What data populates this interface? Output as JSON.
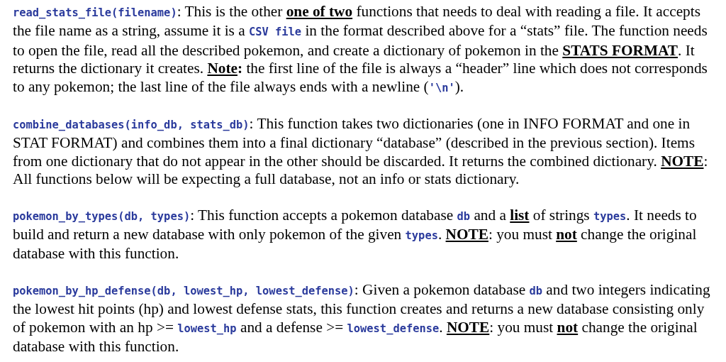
{
  "paragraphs": [
    {
      "segments": [
        {
          "kind": "code",
          "text": "read_stats_file(filename)"
        },
        {
          "kind": "text",
          "text": ": This is the other "
        },
        {
          "kind": "emph",
          "text": "one of two"
        },
        {
          "kind": "text",
          "text": " functions that needs to deal with reading a file. It accepts the file name as a string, assume it is a "
        },
        {
          "kind": "code",
          "text": "CSV file"
        },
        {
          "kind": "text",
          "text": " in the format described above for a “stats” file. The function needs to open the file, read all the described pokemon, and create a dictionary of pokemon in the "
        },
        {
          "kind": "emph",
          "text": "STATS FORMAT"
        },
        {
          "kind": "text",
          "text": ". It returns the dictionary it creates. "
        },
        {
          "kind": "emph",
          "text": "Note"
        },
        {
          "kind": "bold",
          "text": ":"
        },
        {
          "kind": "text",
          "text": " the first line of the file is always a “header” line which does not corresponds to any pokemon; the last line of the file always ends with a newline ("
        },
        {
          "kind": "code",
          "text": "'\\n'"
        },
        {
          "kind": "text",
          "text": ")."
        }
      ]
    },
    {
      "segments": [
        {
          "kind": "code",
          "text": "combine_databases(info_db, stats_db)"
        },
        {
          "kind": "text",
          "text": ": This function takes two dictionaries (one in INFO FORMAT and one in STAT FORMAT) and combines them into a final dictionary “database” (described in the previous section). Items from one dictionary that do not appear in the other should be discarded. It returns the combined dictionary. "
        },
        {
          "kind": "emph",
          "text": "NOTE"
        },
        {
          "kind": "text",
          "text": ": All functions below will be expecting a full database, not an info or stats dictionary."
        }
      ]
    },
    {
      "segments": [
        {
          "kind": "code",
          "text": "pokemon_by_types(db, types)"
        },
        {
          "kind": "text",
          "text": ": This function accepts a pokemon database "
        },
        {
          "kind": "code",
          "text": "db"
        },
        {
          "kind": "text",
          "text": " and a "
        },
        {
          "kind": "emph",
          "text": "list"
        },
        {
          "kind": "text",
          "text": " of strings "
        },
        {
          "kind": "code",
          "text": "types"
        },
        {
          "kind": "text",
          "text": ". It needs to build and return a new database with only pokemon of the given "
        },
        {
          "kind": "code",
          "text": "types"
        },
        {
          "kind": "text",
          "text": ". "
        },
        {
          "kind": "emph",
          "text": "NOTE"
        },
        {
          "kind": "text",
          "text": ": you must "
        },
        {
          "kind": "emph",
          "text": "not"
        },
        {
          "kind": "text",
          "text": " change the original database with this function."
        }
      ]
    },
    {
      "segments": [
        {
          "kind": "code",
          "text": "pokemon_by_hp_defense(db, lowest_hp, lowest_defense)"
        },
        {
          "kind": "text",
          "text": ": Given a pokemon database "
        },
        {
          "kind": "code",
          "text": "db"
        },
        {
          "kind": "text",
          "text": " and two integers indicating the lowest hit points (hp) and lowest defense stats, this function creates and returns a new database consisting only of pokemon with an hp >= "
        },
        {
          "kind": "code",
          "text": "lowest_hp"
        },
        {
          "kind": "text",
          "text": " and a defense >= "
        },
        {
          "kind": "code",
          "text": "lowest_defense"
        },
        {
          "kind": "text",
          "text": ". "
        },
        {
          "kind": "emph",
          "text": "NOTE"
        },
        {
          "kind": "text",
          "text": ": you must "
        },
        {
          "kind": "emph",
          "text": "not"
        },
        {
          "kind": "text",
          "text": " change the original database with this function."
        }
      ]
    }
  ]
}
